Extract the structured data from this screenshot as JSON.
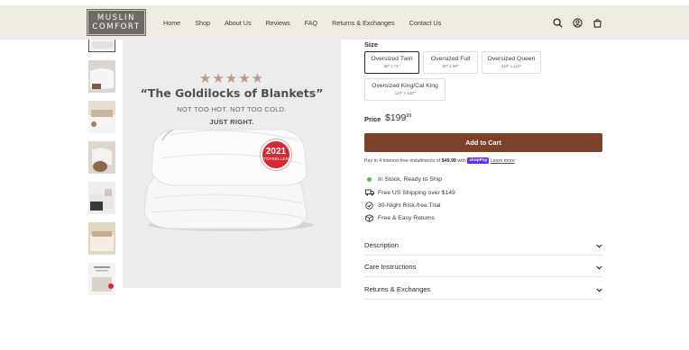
{
  "header": {
    "logo_line1": "MUSLIN",
    "logo_line2": "COMFORT",
    "nav": [
      "Home",
      "Shop",
      "About Us",
      "Reviews",
      "FAQ",
      "Returns & Exchanges",
      "Contact Us"
    ],
    "icons": [
      "search-icon",
      "account-icon",
      "cart-icon"
    ]
  },
  "hero": {
    "stars": "★★★★★",
    "headline": "“The Goldilocks of Blankets”",
    "sub1": "NOT TOO HOT. NOT TOO COLD.",
    "sub2": "JUST RIGHT.",
    "badge_year": "2021",
    "badge_text": "TOPSELLER"
  },
  "product": {
    "size_label": "Size",
    "sizes": [
      {
        "name": "Oversized Twin",
        "dims": "68\" x 71\"",
        "selected": true
      },
      {
        "name": "Oversized Full",
        "dims": "80\" x 88\"",
        "selected": false
      },
      {
        "name": "Oversized Queen",
        "dims": "110\" x 110\"",
        "selected": false
      },
      {
        "name": "Oversized King/Cal King",
        "dims": "120\" x 120\"",
        "selected": false
      }
    ],
    "price_label": "Price",
    "price_main": "$199",
    "price_cents": "99",
    "add_to_cart": "Add to Cart",
    "installments_prefix": "Pay in 4 interest-free installments of ",
    "installments_amount": "$49.99",
    "installments_with": " with ",
    "shop_pay": "shopPay",
    "learn_more": "Learn more",
    "features": [
      {
        "icon": "in-stock-dot-icon",
        "text": "In Stock, Ready to Ship"
      },
      {
        "icon": "truck-icon",
        "text": "Free US Shipping over $149"
      },
      {
        "icon": "check-circle-icon",
        "text": "30-Night Risk-free Trial"
      },
      {
        "icon": "box-icon",
        "text": "Free & Easy Returns"
      }
    ],
    "accordions": [
      "Description",
      "Care Instructions",
      "Returns & Exchanges"
    ]
  },
  "colors": {
    "header_bg": "#efebe3",
    "cart_button": "#7a4329",
    "badge": "#d52b34",
    "in_stock": "#4bc14f",
    "shop_pay": "#5a31f4"
  }
}
